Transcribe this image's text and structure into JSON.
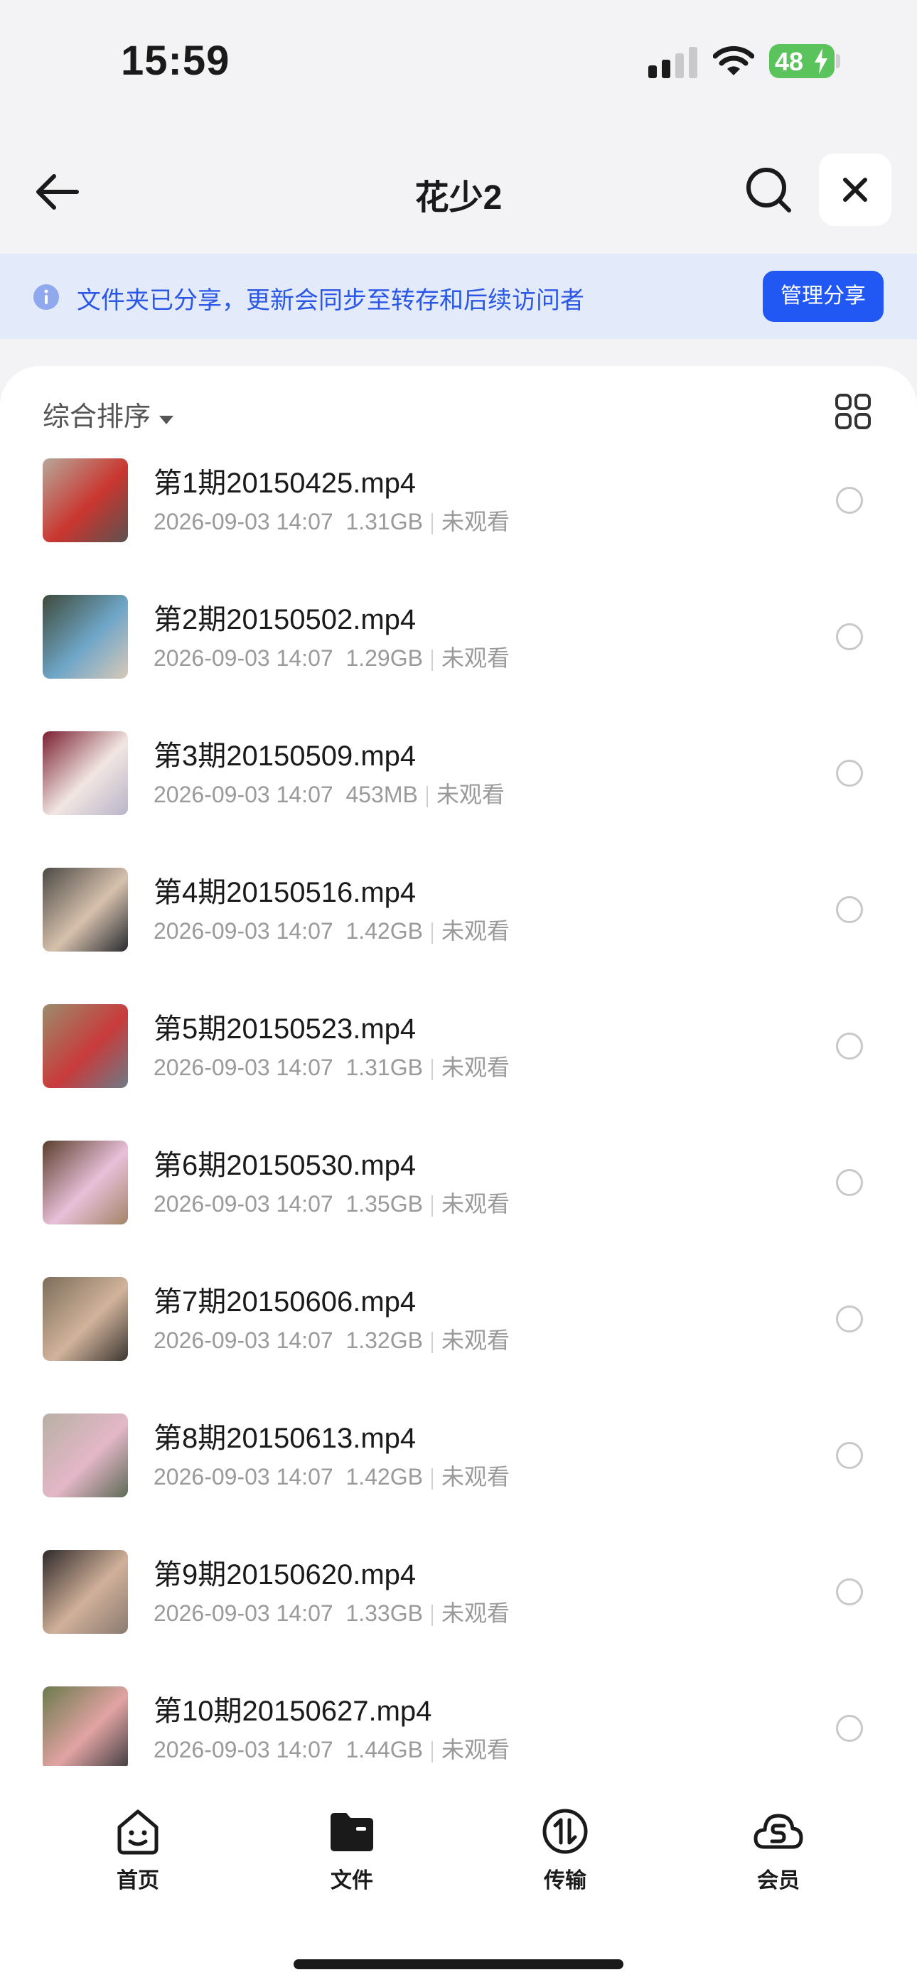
{
  "status_bar": {
    "time": "15:59",
    "battery": "48"
  },
  "header": {
    "title": "花少2"
  },
  "banner": {
    "text": "文件夹已分享，更新会同步至转存和后续访问者",
    "button_label": "管理分享",
    "accent_color": "#2157f2"
  },
  "sort": {
    "label": "综合排序"
  },
  "files": [
    {
      "name": "第1期20150425.mp4",
      "date": "2026-09-03 14:07",
      "size": "1.31GB",
      "status": "未观看"
    },
    {
      "name": "第2期20150502.mp4",
      "date": "2026-09-03 14:07",
      "size": "1.29GB",
      "status": "未观看"
    },
    {
      "name": "第3期20150509.mp4",
      "date": "2026-09-03 14:07",
      "size": "453MB",
      "status": "未观看"
    },
    {
      "name": "第4期20150516.mp4",
      "date": "2026-09-03 14:07",
      "size": "1.42GB",
      "status": "未观看"
    },
    {
      "name": "第5期20150523.mp4",
      "date": "2026-09-03 14:07",
      "size": "1.31GB",
      "status": "未观看"
    },
    {
      "name": "第6期20150530.mp4",
      "date": "2026-09-03 14:07",
      "size": "1.35GB",
      "status": "未观看"
    },
    {
      "name": "第7期20150606.mp4",
      "date": "2026-09-03 14:07",
      "size": "1.32GB",
      "status": "未观看"
    },
    {
      "name": "第8期20150613.mp4",
      "date": "2026-09-03 14:07",
      "size": "1.42GB",
      "status": "未观看"
    },
    {
      "name": "第9期20150620.mp4",
      "date": "2026-09-03 14:07",
      "size": "1.33GB",
      "status": "未观看"
    },
    {
      "name": "第10期20150627.mp4",
      "date": "2026-09-03 14:07",
      "size": "1.44GB",
      "status": "未观看"
    }
  ],
  "tabs": [
    {
      "label": "首页",
      "icon": "home-face-icon"
    },
    {
      "label": "文件",
      "icon": "folder-icon"
    },
    {
      "label": "传输",
      "icon": "transfer-icon"
    },
    {
      "label": "会员",
      "icon": "cloud-member-icon"
    }
  ]
}
